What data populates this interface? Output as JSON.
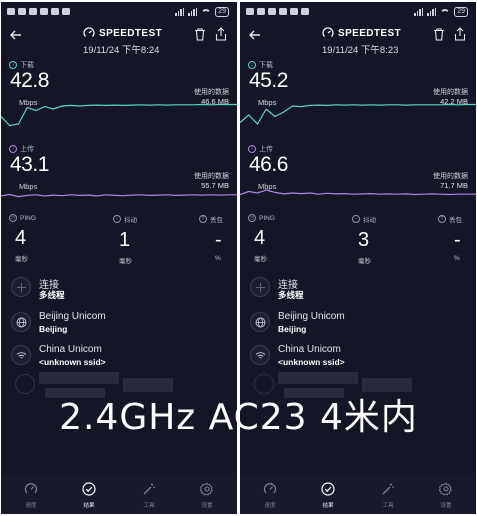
{
  "overlay_caption": "2.4GHz AC23 4米内",
  "colors": {
    "background": "#141626",
    "download_accent": "#5fd3c1",
    "upload_accent": "#b483ec",
    "page_bg": "#ffffff"
  },
  "panels": [
    {
      "status": {
        "battery": "29"
      },
      "header": {
        "app_name": "SPEEDTEST",
        "datetime": "19/11/24 下午8:24"
      },
      "download": {
        "label": "下载",
        "value": "42.8",
        "unit": "Mbps",
        "used_label": "使用的数据",
        "used_value": "46.6 MB",
        "trace": [
          0.55,
          0.85,
          0.8,
          0.25,
          0.35,
          0.22,
          0.3,
          0.2,
          0.18,
          0.2,
          0.18,
          0.17,
          0.18,
          0.17,
          0.18,
          0.17,
          0.16,
          0.17,
          0.16,
          0.17,
          0.16,
          0.16,
          0.16,
          0.15,
          0.16,
          0.15,
          0.15,
          0.15
        ]
      },
      "upload": {
        "label": "上传",
        "value": "43.1",
        "unit": "Mbps",
        "used_label": "使用的数据",
        "used_value": "55.7 MB",
        "trace": [
          0.4,
          0.35,
          0.42,
          0.38,
          0.36,
          0.4,
          0.37,
          0.39,
          0.36,
          0.38,
          0.37,
          0.4,
          0.36,
          0.38,
          0.39,
          0.37,
          0.36,
          0.38,
          0.37,
          0.36,
          0.38,
          0.37,
          0.36,
          0.37,
          0.36,
          0.37,
          0.36,
          0.36
        ]
      },
      "ping": {
        "label": "PING",
        "value": "4",
        "unit": "毫秒"
      },
      "jitter": {
        "label": "抖动",
        "value": "1",
        "unit": "毫秒"
      },
      "loss": {
        "label": "丢包",
        "value": "-",
        "unit": "%"
      },
      "connection": {
        "title": "连接",
        "sub": "多线程"
      },
      "server": {
        "title": "Beijing Unicom",
        "sub": "Beijing"
      },
      "network": {
        "title": "China Unicom",
        "sub": "<unknown ssid>"
      },
      "tabs": [
        {
          "label": "速度"
        },
        {
          "label": "结果"
        },
        {
          "label": "工具"
        },
        {
          "label": "设置"
        }
      ]
    },
    {
      "status": {
        "battery": "29"
      },
      "header": {
        "app_name": "SPEEDTEST",
        "datetime": "19/11/24 下午8:23"
      },
      "download": {
        "label": "下载",
        "value": "45.2",
        "unit": "Mbps",
        "used_label": "使用的数据",
        "used_value": "42.2 MB",
        "trace": [
          0.75,
          0.5,
          0.8,
          0.3,
          0.55,
          0.4,
          0.2,
          0.22,
          0.18,
          0.17,
          0.18,
          0.16,
          0.17,
          0.16,
          0.17,
          0.16,
          0.17,
          0.16,
          0.16,
          0.17,
          0.16,
          0.16,
          0.16,
          0.16,
          0.15,
          0.16,
          0.15,
          0.15
        ]
      },
      "upload": {
        "label": "上传",
        "value": "46.6",
        "unit": "Mbps",
        "used_label": "使用的数据",
        "used_value": "71.7 MB",
        "trace": [
          0.35,
          0.25,
          0.3,
          0.2,
          0.28,
          0.33,
          0.3,
          0.32,
          0.3,
          0.34,
          0.31,
          0.33,
          0.32,
          0.34,
          0.33,
          0.32,
          0.34,
          0.33,
          0.34,
          0.33,
          0.35,
          0.34,
          0.33,
          0.34,
          0.35,
          0.34,
          0.34,
          0.34
        ]
      },
      "ping": {
        "label": "PING",
        "value": "4",
        "unit": "毫秒"
      },
      "jitter": {
        "label": "抖动",
        "value": "3",
        "unit": "毫秒"
      },
      "loss": {
        "label": "丢包",
        "value": "-",
        "unit": "%"
      },
      "connection": {
        "title": "连接",
        "sub": "多线程"
      },
      "server": {
        "title": "Beijing Unicom",
        "sub": "Beijing"
      },
      "network": {
        "title": "China Unicom",
        "sub": "<unknown ssid>"
      },
      "tabs": [
        {
          "label": "速度"
        },
        {
          "label": "结果"
        },
        {
          "label": "工具"
        },
        {
          "label": "设置"
        }
      ]
    }
  ]
}
